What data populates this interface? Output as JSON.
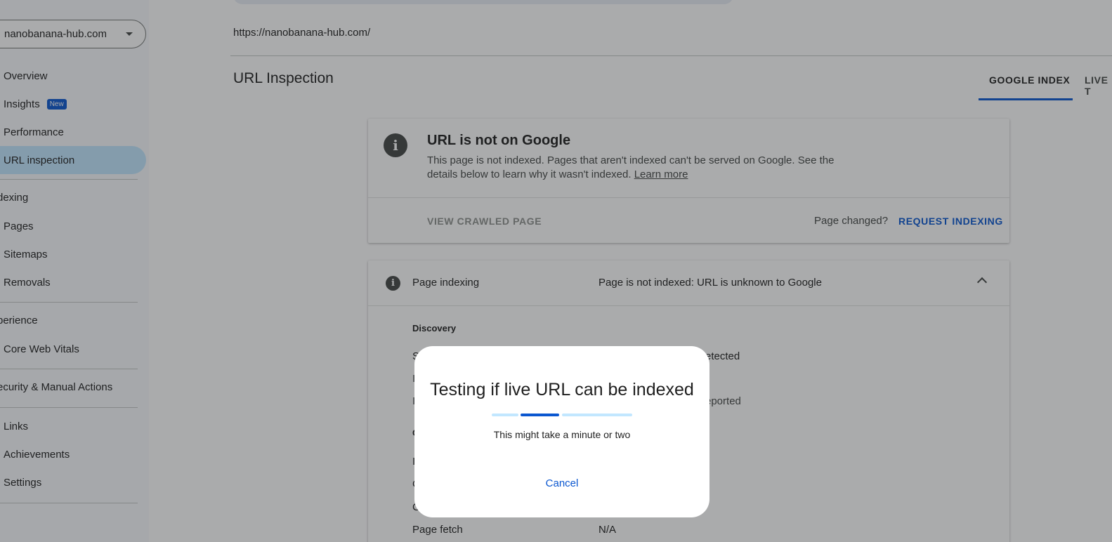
{
  "property": "nanobanana-hub.com",
  "sidebar": {
    "items": [
      {
        "label": "Overview"
      },
      {
        "label": "Insights",
        "badge": "New"
      },
      {
        "label": "Performance"
      },
      {
        "label": "URL inspection"
      }
    ],
    "sections": {
      "indexing": "dexing",
      "experience": "perience",
      "security": "ecurity & Manual Actions"
    },
    "indexing_items": [
      "Pages",
      "Sitemaps",
      "Removals"
    ],
    "experience_items": [
      "Core Web Vitals"
    ],
    "bottom_items": [
      "Links",
      "Achievements",
      "Settings"
    ]
  },
  "inspected_url": "https://nanobanana-hub.com/",
  "page_title": "URL Inspection",
  "tabs": [
    "GOOGLE INDEX",
    "LIVE T"
  ],
  "status_card": {
    "title": "URL is not on Google",
    "description": "This page is not indexed. Pages that aren't indexed can't be served on Google. See the details below to learn why it wasn't indexed.",
    "learn_more": "Learn more",
    "view_crawled": "VIEW CRAWLED PAGE",
    "page_changed": "Page changed?",
    "request_indexing": "REQUEST INDEXING"
  },
  "indexing_card": {
    "label": "Page indexing",
    "status": "Page is not indexed: URL is unknown to Google",
    "discovery_heading": "Discovery",
    "partial_rows": [
      "S",
      "I",
      "I"
    ],
    "partial_values": [
      "etected",
      "eported"
    ],
    "crawl_heading_partial": "C",
    "crawl_partial_rows": [
      "I",
      "C",
      "C"
    ],
    "page_fetch_label": "Page fetch",
    "page_fetch_value": "N/A"
  },
  "dialog": {
    "title": "Testing if live URL can be indexed",
    "subtitle": "This might take a minute or two",
    "cancel": "Cancel",
    "progress_colors": {
      "track": "#c2e7ff",
      "indicator": "#0b57d0"
    }
  },
  "colors": {
    "accent": "#0b57d0",
    "active_nav": "#c2e7ff"
  }
}
